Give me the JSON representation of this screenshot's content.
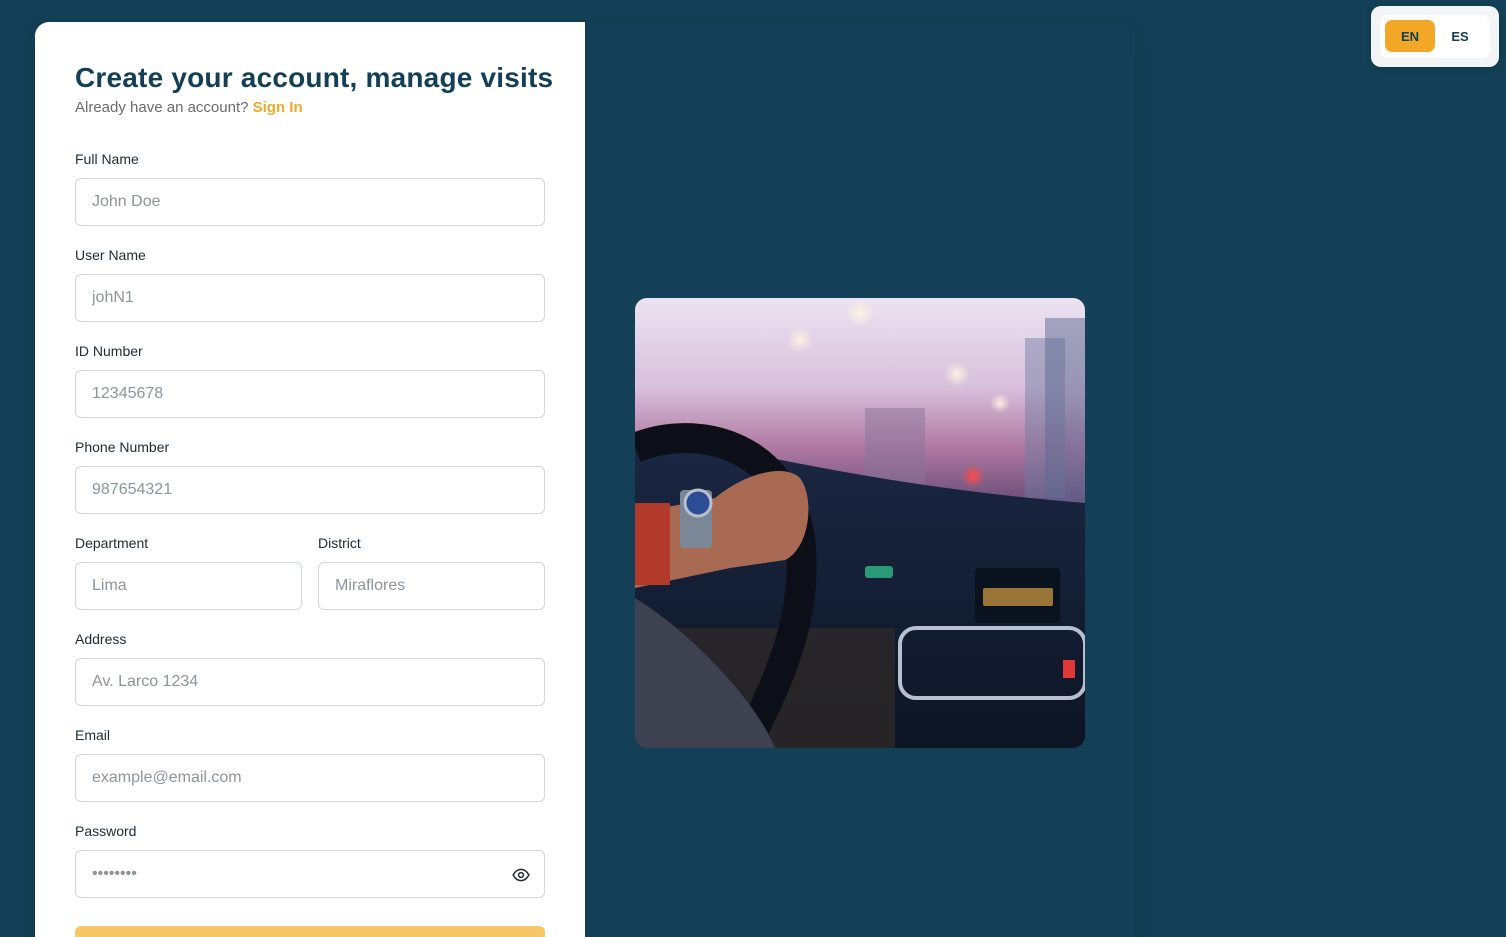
{
  "header": {
    "title": "Create your account, manage visits",
    "subtitle_text": "Already have an account?",
    "signin_link": "Sign In"
  },
  "form": {
    "fields": [
      {
        "label": "Full Name",
        "placeholder": "John Doe"
      },
      {
        "label": "User Name",
        "placeholder": "johN1"
      },
      {
        "label": "ID Number",
        "placeholder": "12345678"
      },
      {
        "label": "Phone Number",
        "placeholder": "987654321"
      },
      {
        "label": "Department",
        "placeholder": "Lima"
      },
      {
        "label": "District",
        "placeholder": "Miraflores"
      },
      {
        "label": "Address",
        "placeholder": "Av. Larco 1234"
      },
      {
        "label": "Email",
        "placeholder": "example@email.com"
      },
      {
        "label": "Password",
        "placeholder": "••••••••"
      }
    ],
    "password_toggle_icon": "eye-icon"
  },
  "language": {
    "options": [
      "EN",
      "ES"
    ],
    "selected": "EN"
  },
  "colors": {
    "primary": "#134056",
    "accent": "#f2a826",
    "submit": "#f6c766"
  },
  "image": {
    "subject": "car-driving-at-dusk"
  }
}
